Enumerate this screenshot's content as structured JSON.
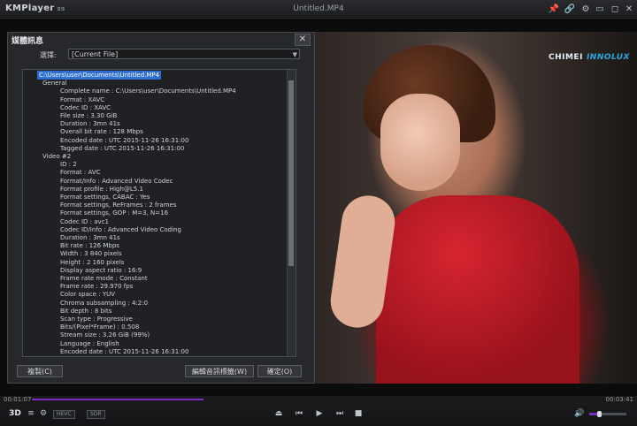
{
  "app": {
    "logo": "KMPlayer",
    "logo_sub": "ss",
    "window_title": "Untitled.MP4"
  },
  "window_controls": [
    "📌",
    "🔗",
    "⚙",
    "▭",
    "◻",
    "✕"
  ],
  "brand": {
    "part1": "CHIMEI",
    "part2": "INNOLUX"
  },
  "dialog": {
    "title": "媒體訊息",
    "close": "✕",
    "select_label": "選擇:",
    "select_value": "[Current File]",
    "select_arrow": "▼",
    "buttons": {
      "copy": "複製(C)",
      "edit_tags": "編輯音訊標籤(W)",
      "ok": "確定(O)"
    }
  },
  "tree": [
    {
      "t": "C:\\Users\\user\\Documents\\Untitled.MP4",
      "d": 0,
      "root": true
    },
    {
      "t": "General",
      "d": 1
    },
    {
      "t": "Complete name : C:\\Users\\user\\Documents\\Untitled.MP4",
      "d": 2
    },
    {
      "t": "Format : XAVC",
      "d": 2
    },
    {
      "t": "Codec ID : XAVC",
      "d": 2
    },
    {
      "t": "File size : 3.30 GiB",
      "d": 2
    },
    {
      "t": "Duration : 3mn 41s",
      "d": 2
    },
    {
      "t": "Overall bit rate : 128 Mbps",
      "d": 2
    },
    {
      "t": "Encoded date : UTC 2015-11-26 16:31:00",
      "d": 2
    },
    {
      "t": "Tagged date : UTC 2015-11-26 16:31:00",
      "d": 2
    },
    {
      "t": "Video #2",
      "d": 1
    },
    {
      "t": "ID : 2",
      "d": 2
    },
    {
      "t": "Format : AVC",
      "d": 2
    },
    {
      "t": "Format/Info : Advanced Video Codec",
      "d": 2
    },
    {
      "t": "Format profile : High@L5.1",
      "d": 2
    },
    {
      "t": "Format settings, CABAC : Yes",
      "d": 2
    },
    {
      "t": "Format settings, ReFrames : 2 frames",
      "d": 2
    },
    {
      "t": "Format settings, GOP : M=3, N=16",
      "d": 2
    },
    {
      "t": "Codec ID : avc1",
      "d": 2
    },
    {
      "t": "Codec ID/Info : Advanced Video Coding",
      "d": 2
    },
    {
      "t": "Duration : 3mn 41s",
      "d": 2
    },
    {
      "t": "Bit rate : 126 Mbps",
      "d": 2
    },
    {
      "t": "Width : 3 840 pixels",
      "d": 2
    },
    {
      "t": "Height : 2 160 pixels",
      "d": 2
    },
    {
      "t": "Display aspect ratio : 16:9",
      "d": 2
    },
    {
      "t": "Frame rate mode : Constant",
      "d": 2
    },
    {
      "t": "Frame rate : 29.970 fps",
      "d": 2
    },
    {
      "t": "Color space : YUV",
      "d": 2
    },
    {
      "t": "Chroma subsampling : 4:2:0",
      "d": 2
    },
    {
      "t": "Bit depth : 8 bits",
      "d": 2
    },
    {
      "t": "Scan type : Progressive",
      "d": 2
    },
    {
      "t": "Bits/(Pixel*Frame) : 0.508",
      "d": 2
    },
    {
      "t": "Stream size : 3.26 GiB (99%)",
      "d": 2
    },
    {
      "t": "Language : English",
      "d": 2
    },
    {
      "t": "Encoded date : UTC 2015-11-26 16:31:00",
      "d": 2
    },
    {
      "t": "Tagged date : UTC 2015-11-26 16:31:00",
      "d": 2
    }
  ],
  "playback": {
    "elapsed": "00:01:07",
    "total": "00:03:41",
    "progress_fraction": 0.3,
    "volume_fraction": 0.25
  },
  "controls": {
    "threeD": "3D",
    "menu": "≡",
    "settings": "⚙",
    "hw": "HEVC",
    "enc": "SDR",
    "eject": "⏏",
    "prev": "⏮",
    "play": "▶",
    "next": "⏭",
    "stop": "■",
    "volume": "🔊"
  },
  "colors": {
    "accent": "#7a2dc1",
    "selection": "#2f6fd3"
  }
}
